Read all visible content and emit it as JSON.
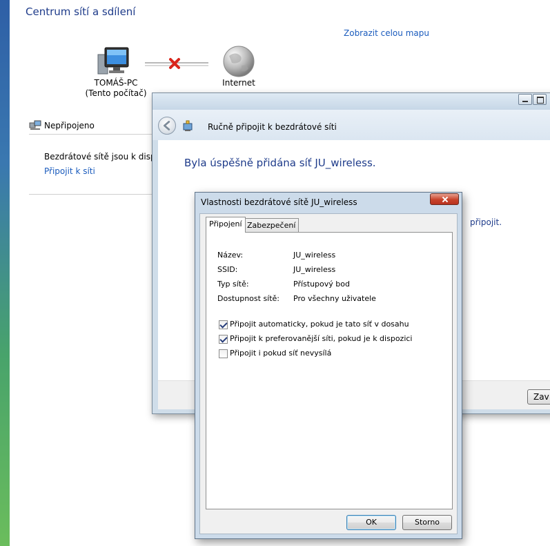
{
  "network_center": {
    "title": "Centrum sítí a sdílení",
    "show_map_link": "Zobrazit celou mapu",
    "computer_name": "TOMÁŠ-PC",
    "computer_subtitle": "(Tento počítač)",
    "internet_label": "Internet",
    "status_label": "Nepřipojeno",
    "wireless_text": "Bezdrátové sítě jsou k dispozic",
    "connect_link": "Připojit k síti"
  },
  "wizard": {
    "title": "Ručně připojit k bezdrátové síti",
    "success_message": "Byla úspěšně přidána síť JU_wireless.",
    "partial_text": "připojit.",
    "close_button_partial": "Zav"
  },
  "properties_dialog": {
    "title": "Vlastnosti bezdrátové sítě JU_wireless",
    "tabs": [
      {
        "label": "Připojení",
        "active": true
      },
      {
        "label": "Zabezpečení",
        "active": false
      }
    ],
    "fields": {
      "name_label": "Název:",
      "name_value": "JU_wireless",
      "ssid_label": "SSID:",
      "ssid_value": "JU_wireless",
      "type_label": "Typ sítě:",
      "type_value": "Přístupový bod",
      "availability_label": "Dostupnost sítě:",
      "availability_value": "Pro všechny uživatele"
    },
    "checkboxes": [
      {
        "label": "Připojit automaticky, pokud je tato síť v dosahu",
        "checked": true
      },
      {
        "label": "Připojit k preferovanější síti, pokud je k dispozici",
        "checked": true
      },
      {
        "label": "Připojit i pokud síť nevysílá",
        "checked": false
      }
    ],
    "ok_label": "OK",
    "cancel_label": "Storno"
  },
  "colors": {
    "link": "#1a5bbd",
    "heading": "#1e3b8a",
    "dialog_frame": "#ccdbea",
    "close_button": "#c8432b"
  }
}
